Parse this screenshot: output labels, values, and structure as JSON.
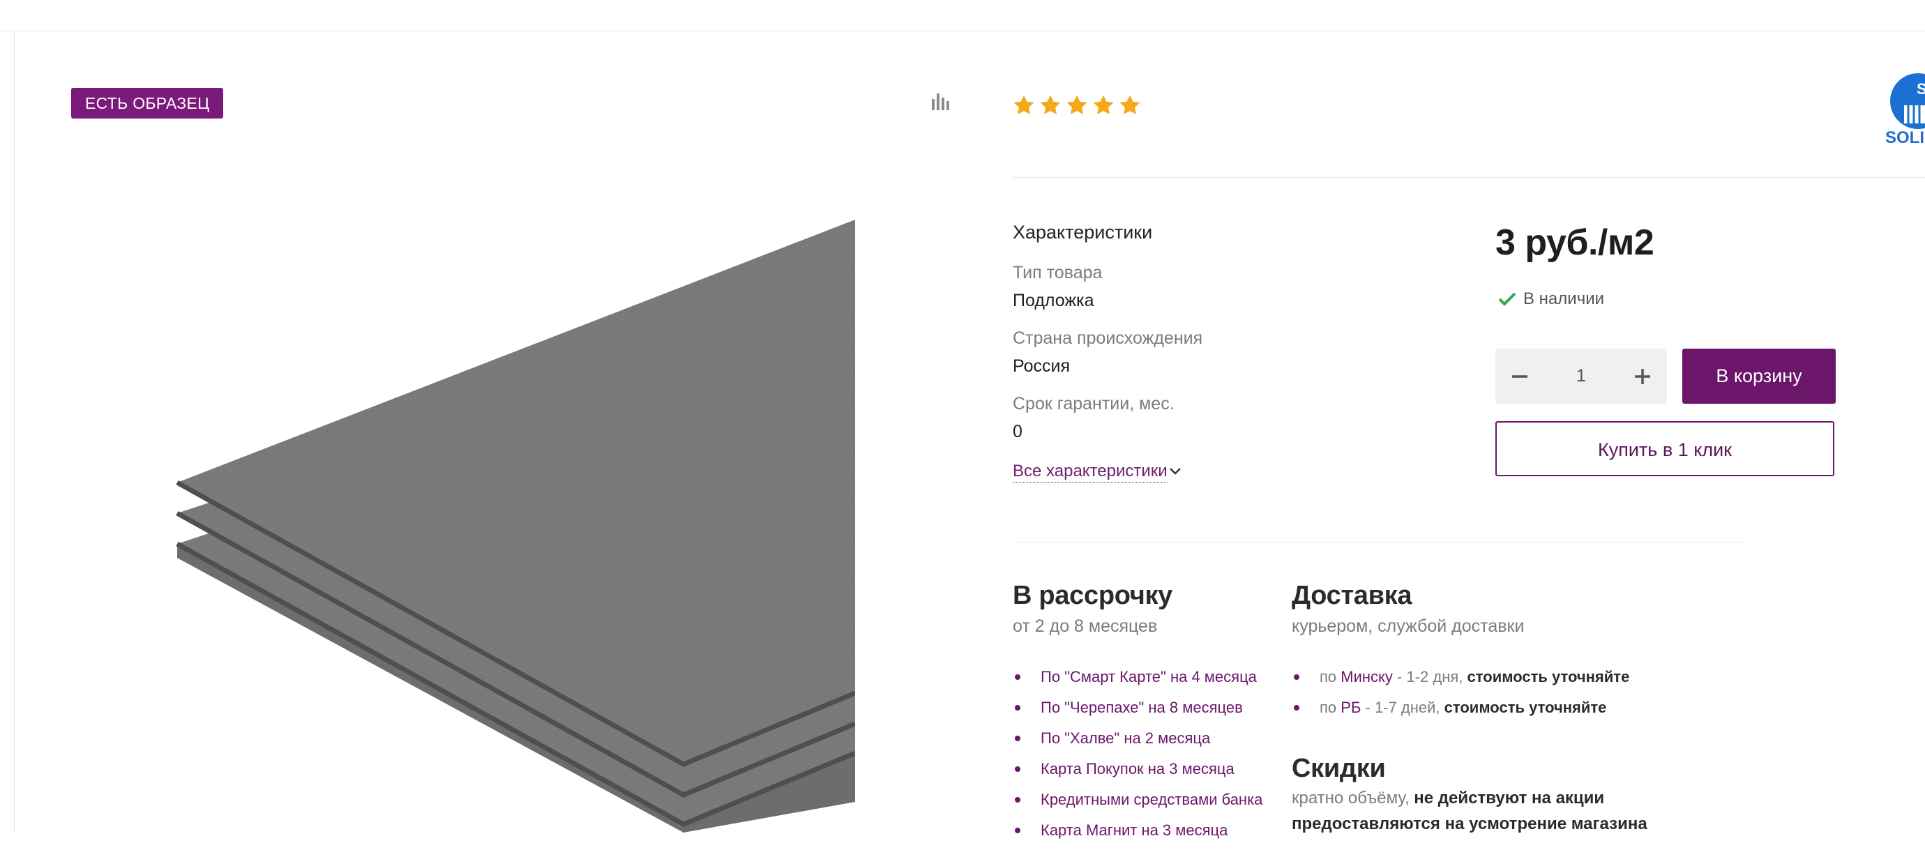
{
  "badge": {
    "label": "ЕСТЬ ОБРАЗЕЦ"
  },
  "rating": {
    "stars": 5,
    "max": 5,
    "color": "#f5a91a"
  },
  "specs": {
    "title": "Характеристики",
    "rows": [
      {
        "label": "Тип товара",
        "value": "Подложка"
      },
      {
        "label": "Страна происхождения",
        "value": "Россия"
      },
      {
        "label": "Срок гарантии, мес.",
        "value": "0"
      }
    ],
    "all_link": "Все характеристики"
  },
  "price": "3 руб./м2",
  "stock": "В наличии",
  "quantity": "1",
  "buttons": {
    "cart": "В корзину",
    "one_click": "Купить в 1 клик"
  },
  "installment": {
    "title": "В рассрочку",
    "subtitle": "от 2 до 8 месяцев",
    "items": [
      "По \"Смарт Карте\" на 4 месяца",
      "По \"Черепахе\" на 8 месяцев",
      "По \"Халве\" на 2 месяца",
      "Карта Покупок на 3 месяца",
      "Кредитными средствами банка",
      "Карта Магнит на 3 месяца"
    ]
  },
  "delivery": {
    "title": "Доставка",
    "subtitle": "курьером, службой доставки",
    "items": [
      {
        "prefix": "по",
        "place": "Минску",
        "term": "- 1-2 дня,",
        "note": "стоимость уточняйте"
      },
      {
        "prefix": "по",
        "place": "РБ",
        "term": "- 1-7 дней,",
        "note": "стоимость уточняйте"
      }
    ]
  },
  "discounts": {
    "title": "Скидки",
    "line1_normal": "кратно объёму,",
    "line1_bold": "не действуют на акции",
    "line2_bold": "предоставляются на усмотрение магазина"
  },
  "brand": {
    "text": "SOLI",
    "color": "#1d6fd1"
  },
  "colors": {
    "accent": "#6c166b",
    "badge": "#7c1a7b",
    "check": "#3aa655"
  }
}
